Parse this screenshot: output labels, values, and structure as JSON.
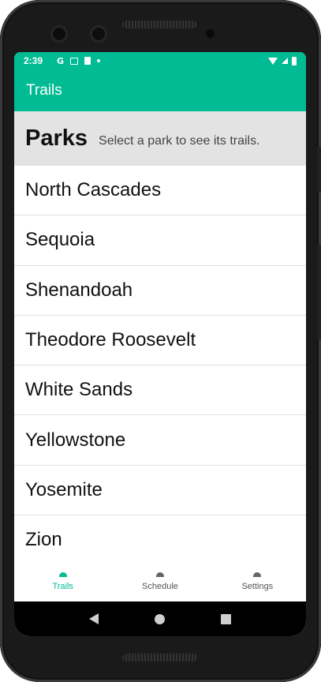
{
  "status_bar": {
    "time": "2:39",
    "left_icons": [
      "google-icon",
      "gmail-icon",
      "sim-card-icon",
      "notification-dot-icon"
    ],
    "right_icons": [
      "wifi-icon",
      "signal-icon",
      "battery-icon"
    ],
    "google_glyph": "G"
  },
  "app_bar": {
    "title": "Trails"
  },
  "header": {
    "title": "Parks",
    "subtitle": "Select a park to see its trails."
  },
  "parks": [
    {
      "name": "North Cascades"
    },
    {
      "name": "Sequoia"
    },
    {
      "name": "Shenandoah"
    },
    {
      "name": "Theodore Roosevelt"
    },
    {
      "name": "White Sands"
    },
    {
      "name": "Yellowstone"
    },
    {
      "name": "Yosemite"
    },
    {
      "name": "Zion"
    }
  ],
  "bottom_nav": {
    "items": [
      {
        "label": "Trails",
        "icon": "trails-icon",
        "active": true
      },
      {
        "label": "Schedule",
        "icon": "schedule-icon",
        "active": false
      },
      {
        "label": "Settings",
        "icon": "settings-icon",
        "active": false
      }
    ]
  },
  "colors": {
    "accent": "#00bb94",
    "header_bg": "#e3e3e3",
    "nav_active": "#00bb94",
    "nav_inactive": "#555555"
  }
}
